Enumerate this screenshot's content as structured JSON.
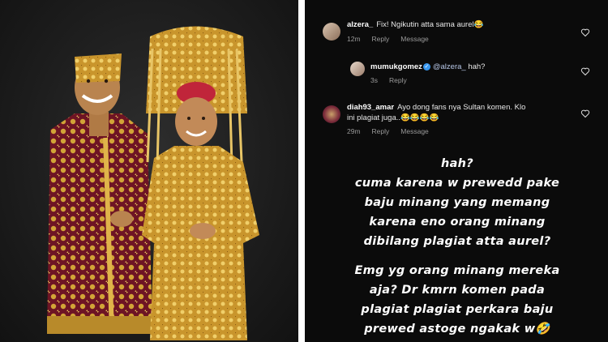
{
  "comments": [
    {
      "username": "alzera_",
      "text": "Fix! Ngikutin atta sama aurel",
      "emoji": "😂",
      "time": "12m",
      "reply": "Reply",
      "message": "Message"
    },
    {
      "username": "mumukgomez",
      "mention": "@alzera_",
      "text": "hah?",
      "time": "3s",
      "reply": "Reply"
    },
    {
      "username": "diah93_amar",
      "text_line1": "Ayo dong fans nya Sultan komen. Klo",
      "text_line2": "ini plagiat juga..",
      "emoji": "😂😂😂😂",
      "time": "29m",
      "reply": "Reply",
      "message": "Message"
    }
  ],
  "caption": {
    "para1": [
      "hah?",
      "cuma karena w prewedd pake",
      "baju minang yang memang",
      "karena eno orang minang",
      "dibilang plagiat atta aurel?"
    ],
    "para2": [
      "Emg yg orang minang mereka",
      "aja? Dr kmrn komen pada",
      "plagiat plagiat perkara baju"
    ],
    "last_line": "prewed astoge ngakak w",
    "last_emoji": "🤣"
  },
  "colors": {
    "photo_bg": "#1e1e1e",
    "story_bg": "#0b0b0b",
    "verified": "#3897f0",
    "velvet": "#6e1424",
    "gold": "#d2a437"
  },
  "icons": [
    "heart-icon",
    "verified-badge-icon"
  ]
}
